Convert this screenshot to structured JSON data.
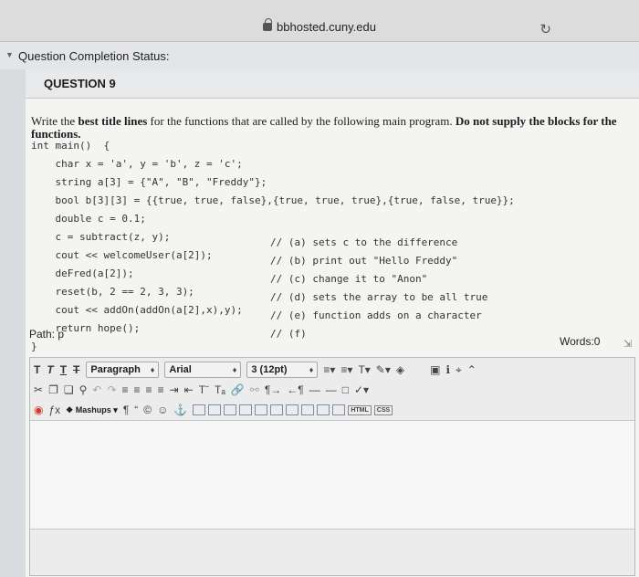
{
  "browser": {
    "url": "bbhosted.cuny.edu"
  },
  "status": {
    "label": "Question Completion Status:"
  },
  "question": {
    "title": "QUESTION 9",
    "prompt": {
      "p1": "Write the ",
      "b1": "best title lines",
      "p2": " for the functions that are called by the following main program. ",
      "b2": "Do not supply the blocks for the",
      "l2": "functions."
    },
    "code": {
      "lines": [
        "int main()  {",
        "    char x = 'a', y = 'b', z = 'c';",
        "    string a[3] = {\"A\", \"B\", \"Freddy\"};",
        "    bool b[3][3] = {{true, true, false},{true, true, true},{true, false, true}};",
        "    double c = 0.1;",
        "    c = subtract(z, y);",
        "    cout << welcomeUser(a[2]);",
        "    deFred(a[2]);",
        "    reset(b, 2 == 2, 3, 3);",
        "    cout << addOn(addOn(a[2],x),y);",
        "    return hope();",
        "}"
      ],
      "comments": [
        "// (a) sets c to the difference",
        "// (b) print out \"Hello Freddy\"",
        "// (c) change it to \"Anon\"",
        "// (d) sets the array to be all true",
        "// (e) function adds on a character",
        "// (f)"
      ]
    }
  },
  "editor": {
    "row1": {
      "format_btns": [
        "T",
        "T",
        "T",
        "T"
      ],
      "paragraph": "Paragraph",
      "font": "Arial",
      "size": "3 (12pt)"
    },
    "row3": {
      "mashups": "Mashups",
      "html": "HTML",
      "css": "CSS"
    },
    "path_label": "Path: p",
    "words_label": "Words:0"
  }
}
